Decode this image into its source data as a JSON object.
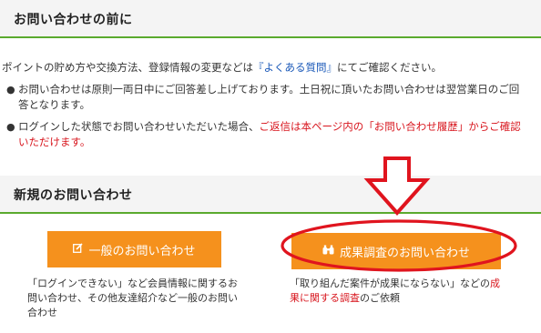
{
  "section1": {
    "title": "お問い合わせの前に"
  },
  "intro": {
    "before": "ポイントの貯め方や交換方法、登録情報の変更などは",
    "link": "『よくある質問』",
    "after": "にてご確認ください。"
  },
  "notes": [
    {
      "text": "お問い合わせは原則一両日中にご回答差し上げております。土日祝に頂いたお問い合わせは翌営業日のご回答となります。",
      "red": ""
    },
    {
      "text": "ログインした状態でお問い合わせいただいた場合、",
      "red": "ご返信は本ページ内の「お問い合わせ履歴」からご確認いただけます。"
    }
  ],
  "section2": {
    "title": "新規のお問い合わせ"
  },
  "buttons": {
    "general": {
      "label": "一般のお問い合わせ",
      "icon": "edit-icon"
    },
    "result": {
      "label": "成果調査のお問い合わせ",
      "icon": "binoculars-icon"
    }
  },
  "descriptions": {
    "general": "「ログインできない」など会員情報に関するお問い合わせ、その他友達紹介など一般のお問い合わせ",
    "result_pre": "「取り組んだ案件が成果にならない」などの",
    "result_red": "成果に関する調査",
    "result_post": "のご依頼"
  },
  "colors": {
    "accent_green": "#5aaa2e",
    "button_orange": "#f5911d",
    "link_blue": "#1a58b8",
    "alert_red": "#d8161e",
    "annotation_red": "#e0141e"
  }
}
